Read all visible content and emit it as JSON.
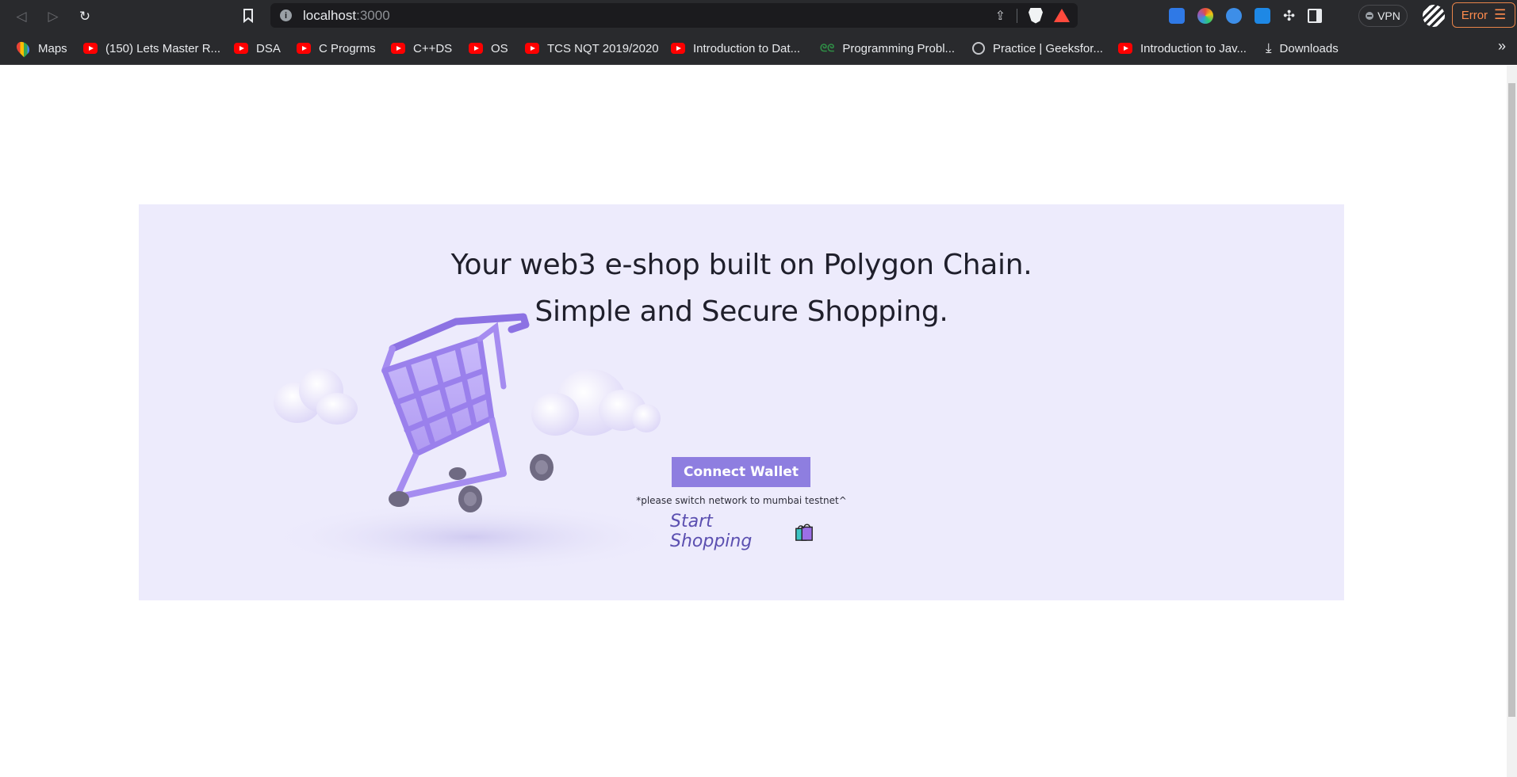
{
  "browser": {
    "url_host": "localhost",
    "url_port": ":3000",
    "vpn_label": "VPN",
    "error_label": "Error"
  },
  "bookmarks": [
    {
      "label": "Maps",
      "icon": "maps-icon"
    },
    {
      "label": "(150) Lets Master R...",
      "icon": "youtube-icon"
    },
    {
      "label": "DSA",
      "icon": "youtube-icon"
    },
    {
      "label": "C Progrms",
      "icon": "youtube-icon"
    },
    {
      "label": "C++DS",
      "icon": "youtube-icon"
    },
    {
      "label": "OS",
      "icon": "youtube-icon"
    },
    {
      "label": "TCS NQT 2019/2020",
      "icon": "youtube-icon"
    },
    {
      "label": "Introduction to Dat...",
      "icon": "youtube-icon"
    },
    {
      "label": "Programming Probl...",
      "icon": "geeksforgeeks-icon"
    },
    {
      "label": "Practice | Geeksfor...",
      "icon": "globe-icon"
    },
    {
      "label": "Introduction to Jav...",
      "icon": "youtube-icon"
    },
    {
      "label": "Downloads",
      "icon": "download-icon"
    }
  ],
  "hero": {
    "headline_line1": "Your web3 e-shop built on Polygon Chain.",
    "headline_line2": "Simple and Secure Shopping.",
    "connect_label": "Connect Wallet",
    "network_note": "*please switch network to mumbai testnet^",
    "start_shopping": "Start Shopping",
    "colors": {
      "background": "#edebfc",
      "button": "#8e7ee0",
      "link": "#5b4fb0",
      "cart": "#a58cf0"
    }
  }
}
